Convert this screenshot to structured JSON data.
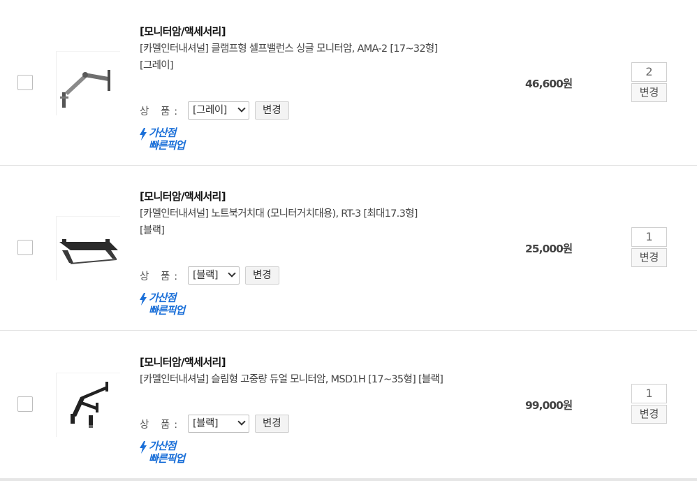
{
  "icons": {
    "checkbox": "checkbox-square",
    "pickup": "lightning-bolt-icon",
    "select": "chevron-down-icon"
  },
  "accent_color": "#1a6fd8",
  "items": [
    {
      "category": "[모니터암/액세서리]",
      "name": "[카멜인터내셔널] 클램프형 셀프밸런스 싱글 모니터암, AMA-2 [17~32형]",
      "option_text": "[그레이]",
      "option_label": "상 품:",
      "option_value": "[그레이]",
      "option_change": "변경",
      "pickup_line1": "가산점",
      "pickup_line2": "빠른픽업",
      "price": "46,600원",
      "qty": "2",
      "qty_change": "변경"
    },
    {
      "category": "[모니터암/액세서리]",
      "name": "[카멜인터내셔널] 노트북거치대 (모니터거치대용), RT-3 [최대17.3형]",
      "option_text": "[블랙]",
      "option_label": "상 품:",
      "option_value": "[블랙]",
      "option_change": "변경",
      "pickup_line1": "가산점",
      "pickup_line2": "빠른픽업",
      "price": "25,000원",
      "qty": "1",
      "qty_change": "변경"
    },
    {
      "category": "[모니터암/액세서리]",
      "name": "[카멜인터내셔널] 슬림형 고중량 듀얼 모니터암, MSD1H [17~35형] [블랙]",
      "option_text": "",
      "option_label": "상 품:",
      "option_value": "[블랙]",
      "option_change": "변경",
      "pickup_line1": "가산점",
      "pickup_line2": "빠른픽업",
      "price": "99,000원",
      "qty": "1",
      "qty_change": "변경"
    }
  ]
}
